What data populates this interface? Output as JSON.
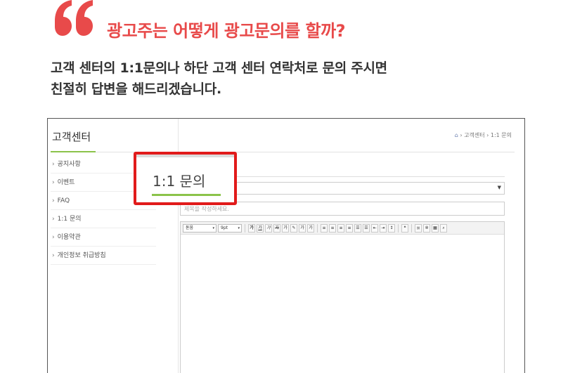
{
  "heading": "광고주는 어떻게 광고문의를 할까?",
  "description": {
    "line1": "고객 센터의 1:1문의나 하단 고객 센터 연락처로 문의 주시면",
    "line2": "친절히 답변을 해드리겠습니다."
  },
  "page": {
    "title": "고객센터",
    "breadcrumb": [
      "고객센터",
      "1:1 문의"
    ]
  },
  "sidebar": {
    "items": [
      {
        "label": "공지사항"
      },
      {
        "label": "이벤트"
      },
      {
        "label": "FAQ"
      },
      {
        "label": "1:1 문의"
      },
      {
        "label": "이용약관"
      },
      {
        "label": "개인정보 취급방침"
      }
    ]
  },
  "form": {
    "title_placeholder": "제목을 작성하세요."
  },
  "editor": {
    "font": "돋움",
    "size": "9pt",
    "buttons": [
      "가",
      "가",
      "가",
      "가",
      "가",
      "가",
      "가"
    ]
  },
  "callout": {
    "title": "1:1 문의"
  },
  "colors": {
    "accent_red": "#e84a4a",
    "highlight_red": "#e11b1b",
    "green": "#8bc34a"
  }
}
